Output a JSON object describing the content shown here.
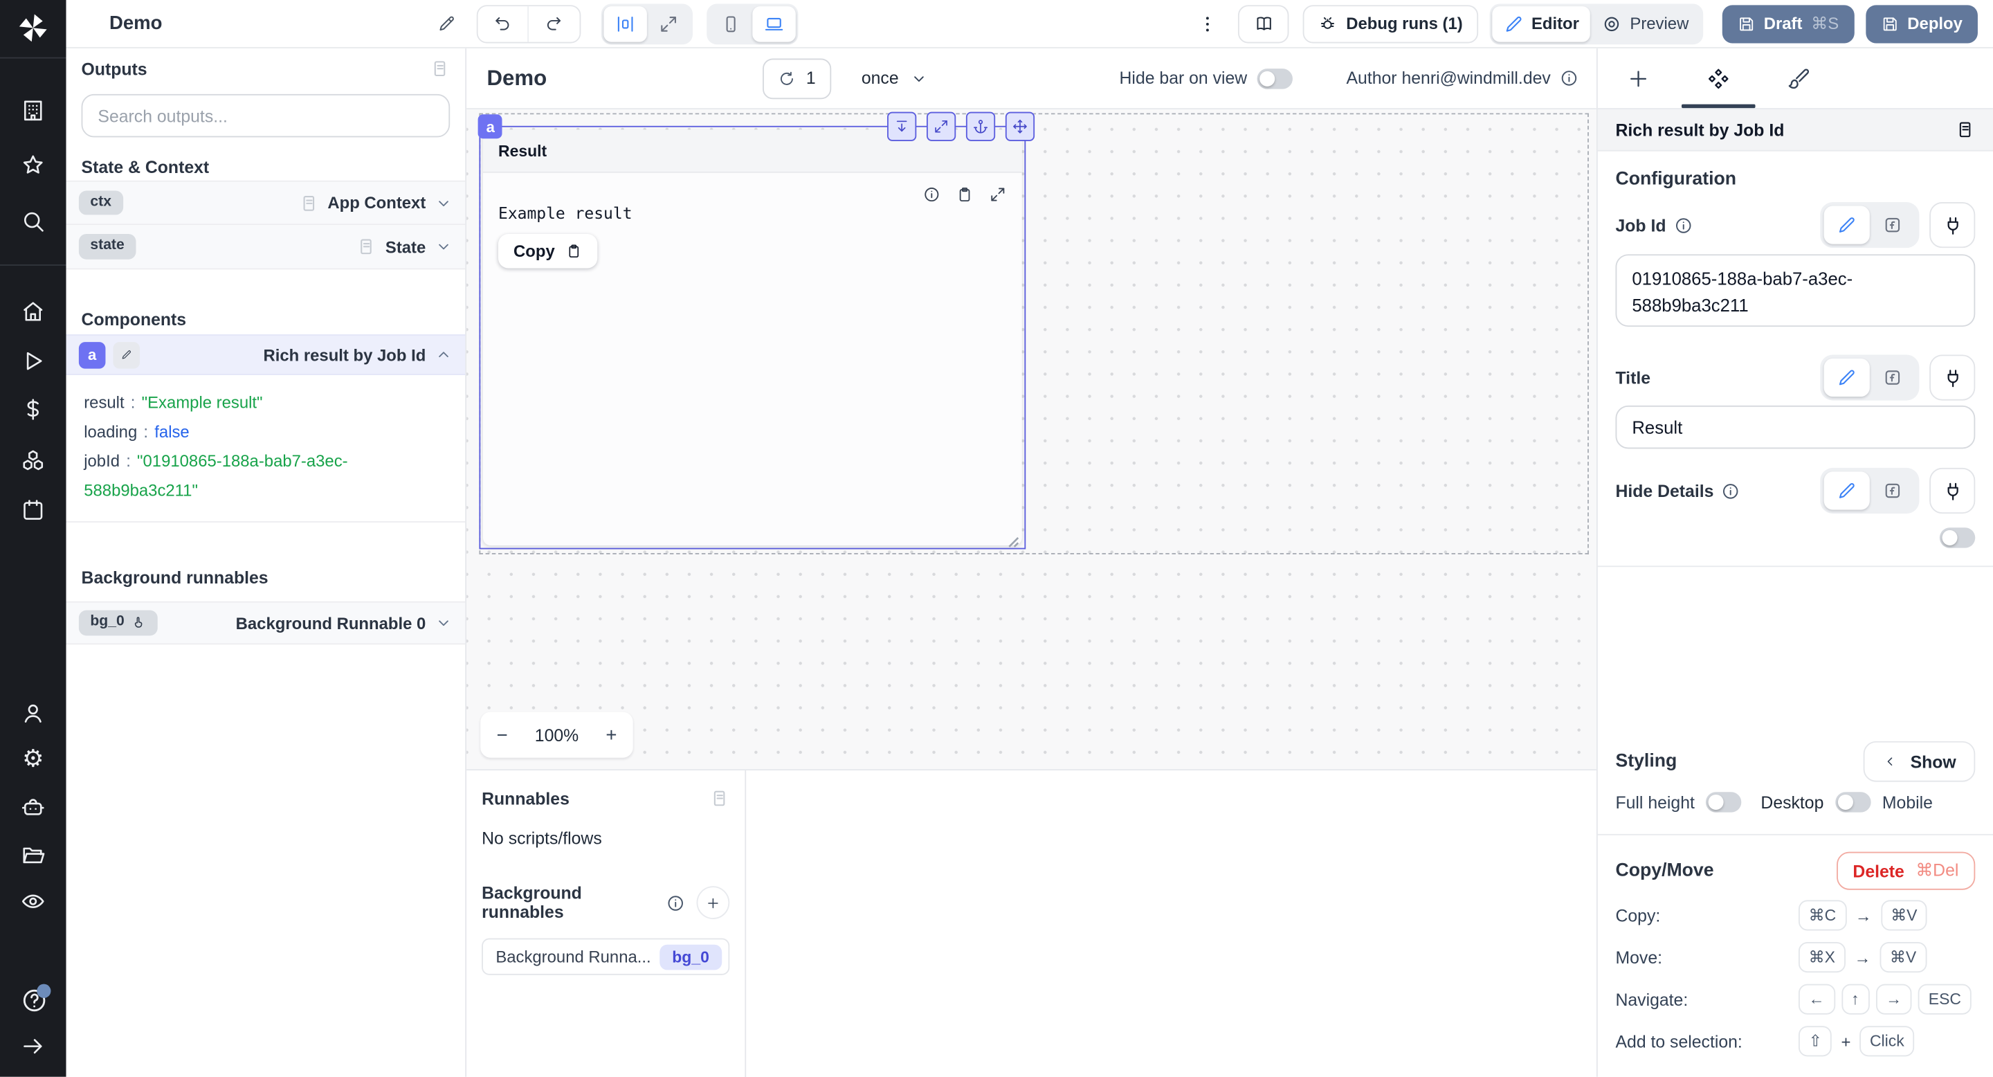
{
  "topbar": {
    "app_title": "Demo",
    "debug_runs_label": "Debug runs (1)",
    "editor_label": "Editor",
    "preview_label": "Preview",
    "draft_label": "Draft",
    "draft_shortcut": "⌘S",
    "deploy_label": "Deploy"
  },
  "sidebar": {
    "icons": [
      "windmill-logo",
      "building",
      "star",
      "search",
      "home",
      "play",
      "dollar",
      "cubes",
      "calendar",
      "user",
      "gear",
      "robot",
      "folder",
      "eye",
      "help",
      "expand-arrow"
    ]
  },
  "left_panel": {
    "outputs_title": "Outputs",
    "search_placeholder": "Search outputs...",
    "state_context_title": "State & Context",
    "ctx": {
      "badge": "ctx",
      "label": "App Context"
    },
    "state": {
      "badge": "state",
      "label": "State"
    },
    "components_title": "Components",
    "component": {
      "badge": "a",
      "label": "Rich result by Job Id",
      "props": [
        {
          "key": "result",
          "sep": ":",
          "value": "\"Example result\""
        },
        {
          "key": "loading",
          "sep": ":",
          "value": "false"
        },
        {
          "key": "jobId",
          "sep": ":",
          "value": "\"01910865-188a-bab7-a3ec-588b9ba3c211\""
        }
      ]
    },
    "background_title": "Background runnables",
    "bg_runnable": {
      "badge": "bg_0",
      "label": "Background Runnable 0"
    }
  },
  "canvas": {
    "title": "Demo",
    "refresh_count": "1",
    "refresh_mode": "once",
    "hide_bar_label": "Hide bar on view",
    "author_label": "Author henri@windmill.dev",
    "component": {
      "tag": "a",
      "title": "Result",
      "content": "Example result",
      "copy_label": "Copy"
    },
    "zoom": {
      "minus": "−",
      "level": "100%",
      "plus": "+"
    }
  },
  "bottom_panel": {
    "runnables_title": "Runnables",
    "empty_text": "No scripts/flows",
    "background_title": "Background runnables",
    "item_label": "Background Runna...",
    "item_badge": "bg_0"
  },
  "right_panel": {
    "header": "Rich result by Job Id",
    "configuration_title": "Configuration",
    "job_id_label": "Job Id",
    "job_id_value": "01910865-188a-bab7-a3ec-588b9ba3c211",
    "title_label": "Title",
    "title_value": "Result",
    "hide_details_label": "Hide Details",
    "styling": {
      "title": "Styling",
      "show_label": "Show",
      "full_height_label": "Full height",
      "desktop_label": "Desktop",
      "mobile_label": "Mobile"
    },
    "copy_move": {
      "title": "Copy/Move",
      "delete_label": "Delete",
      "delete_shortcut": "⌘Del",
      "copy_label": "Copy:",
      "copy_k1": "⌘C",
      "copy_arrow": "→",
      "copy_k2": "⌘V",
      "move_label": "Move:",
      "move_k1": "⌘X",
      "move_arrow": "→",
      "move_k2": "⌘V",
      "navigate_label": "Navigate:",
      "nav_k1": "←",
      "nav_k2": "↑",
      "nav_k3": "→",
      "nav_k4": "ESC",
      "add_label": "Add to selection:",
      "add_k1": "⇧",
      "add_sep": "+",
      "add_k2": "Click"
    }
  },
  "colors": {
    "accent_indigo": "#5b5dde",
    "accent_blue": "#3b82f6",
    "slate_button": "#62789b",
    "string_green": "#18a34a",
    "bool_blue": "#2563eb",
    "delete_red": "#dc2626"
  }
}
